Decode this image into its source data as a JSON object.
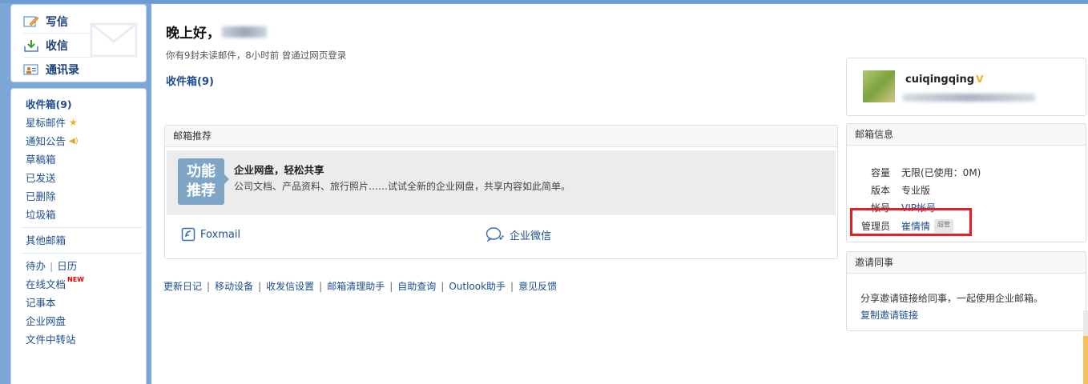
{
  "quick_actions": [
    {
      "label": "写信",
      "icon": "compose-icon"
    },
    {
      "label": "收信",
      "icon": "receive-icon"
    },
    {
      "label": "通讯录",
      "icon": "contacts-icon"
    }
  ],
  "folders": {
    "inbox": "收件箱(9)",
    "starred": "星标邮件",
    "notices": "通知公告",
    "drafts": "草稿箱",
    "sent": "已发送",
    "deleted": "已删除",
    "spam": "垃圾箱",
    "other": "其他邮箱",
    "todo": "待办",
    "calendar": "日历",
    "docs": "在线文档",
    "docs_badge": "NEW",
    "notes": "记事本",
    "drive": "企业网盘",
    "transfer": "文件中转站"
  },
  "main": {
    "greeting": "晚上好，",
    "login_info": "你有9封未读邮件，8小时前 曾通过网页登录",
    "inbox_link": "收件箱(9)"
  },
  "recommend": {
    "title": "邮箱推荐",
    "badge": "功能推荐",
    "badge_line1": "功能",
    "badge_line2": "推荐",
    "promo_title": "企业网盘，轻松共享",
    "promo_desc": "公司文档、产品资料、旅行照片……试试全新的企业网盘，共享内容如此简单。",
    "app1": "Foxmail",
    "app2": "企业微信"
  },
  "footer_links": [
    "更新日记",
    "移动设备",
    "收发信设置",
    "邮箱清理助手",
    "自助查询",
    "Outlook助手",
    "意见反馈"
  ],
  "profile": {
    "username": "cuiqingqing",
    "vip_mark": "V"
  },
  "mailbox_info": {
    "title": "邮箱信息",
    "capacity_label": "容量",
    "capacity_value": "无限(已使用：0M)",
    "edition_label": "版本",
    "edition_value": "专业版",
    "account_label": "帐号",
    "account_value": "VIP帐号",
    "admin_label": "管理员",
    "admin_value": "崔情情",
    "admin_badge": "超管"
  },
  "invite": {
    "title": "邀请同事",
    "text": "分享邀请链接给同事，一起使用企业邮箱。",
    "link": "复制邀请链接"
  },
  "colors": {
    "link_blue": "#1c4d91",
    "highlight_red": "#ea1c24",
    "star_yellow": "#f5b519"
  }
}
